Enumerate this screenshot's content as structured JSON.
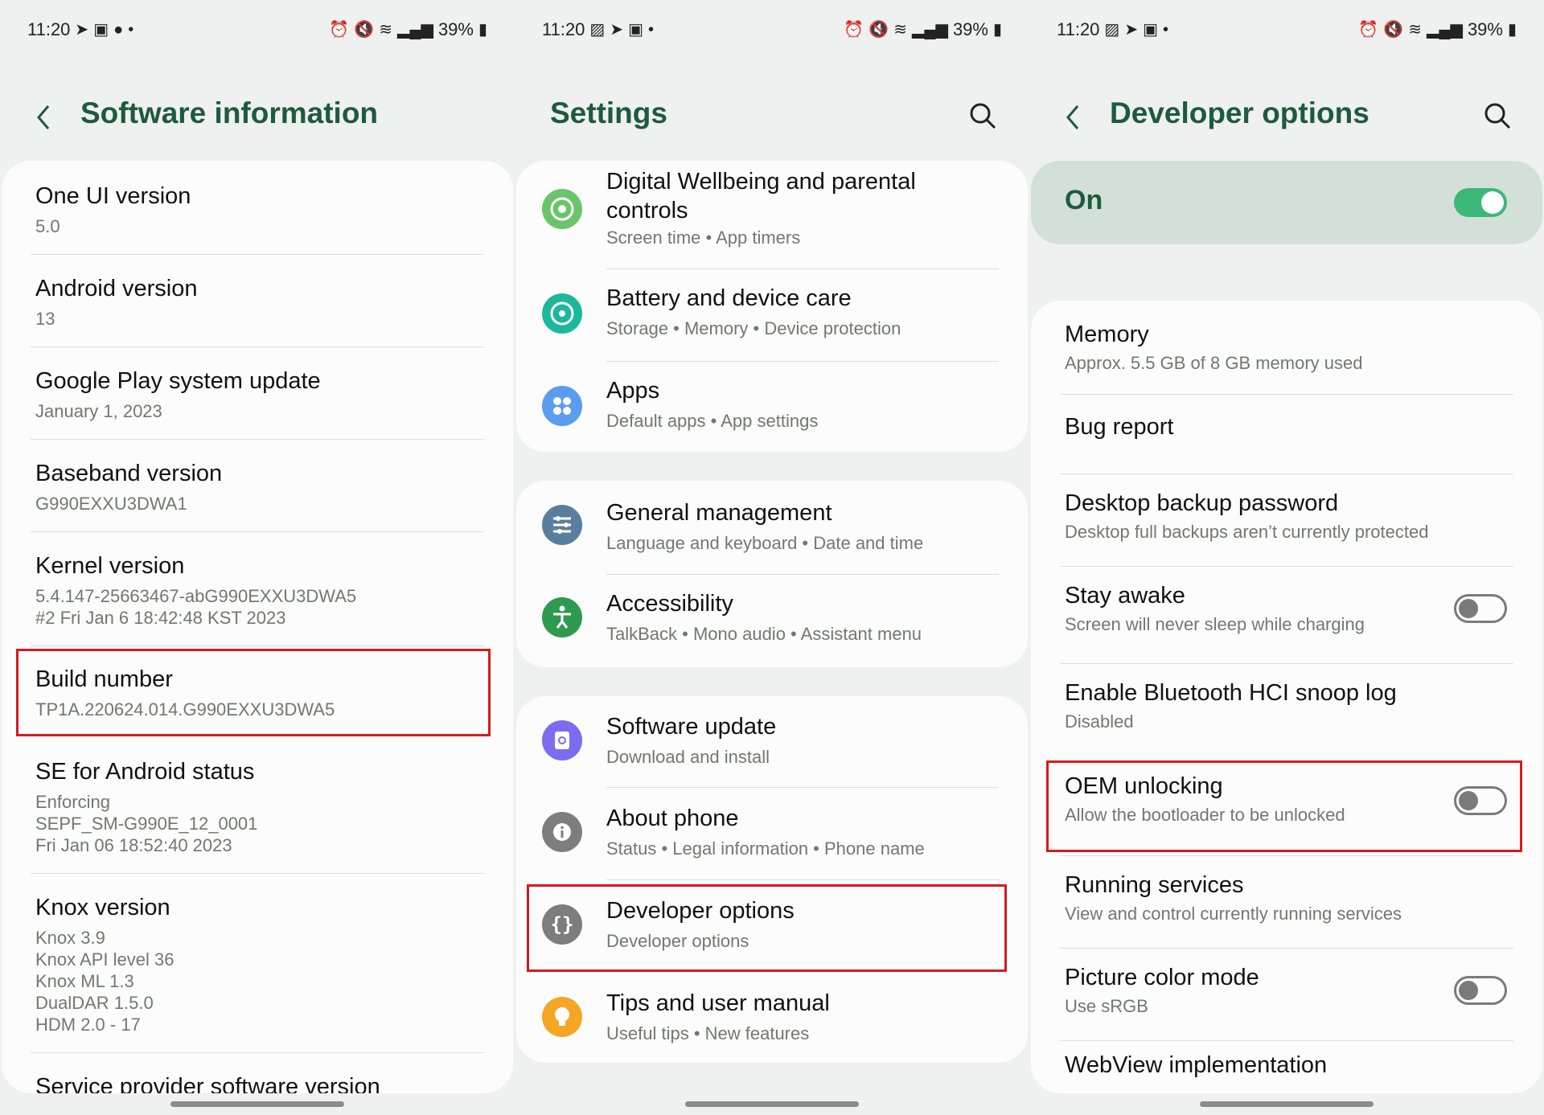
{
  "status_bar": {
    "time": "11:20",
    "battery": "39%"
  },
  "colors": {
    "accent": "#1e5a3e",
    "highlight": "#d71920",
    "toggle_on": "#3cb878"
  },
  "software_info": {
    "title": "Software information",
    "items": [
      {
        "title": "One UI version",
        "lines": [
          "5.0"
        ]
      },
      {
        "title": "Android version",
        "lines": [
          "13"
        ]
      },
      {
        "title": "Google Play system update",
        "lines": [
          "January 1, 2023"
        ]
      },
      {
        "title": "Baseband version",
        "lines": [
          "G990EXXU3DWA1"
        ]
      },
      {
        "title": "Kernel version",
        "lines": [
          "5.4.147-25663467-abG990EXXU3DWA5",
          "#2 Fri Jan 6 18:42:48 KST 2023"
        ]
      },
      {
        "title": "Build number",
        "lines": [
          "TP1A.220624.014.G990EXXU3DWA5"
        ]
      },
      {
        "title": "SE for Android status",
        "lines": [
          "Enforcing",
          "SEPF_SM-G990E_12_0001",
          "Fri Jan 06 18:52:40 2023"
        ]
      },
      {
        "title": "Knox version",
        "lines": [
          "Knox 3.9",
          "Knox API level 36",
          "Knox ML 1.3",
          "DualDAR 1.5.0",
          "HDM 2.0 - 17"
        ]
      },
      {
        "title": "Service provider software version",
        "lines": []
      }
    ]
  },
  "settings": {
    "title": "Settings",
    "items": [
      {
        "title_line1": "Digital Wellbeing and parental",
        "title_line2": "controls",
        "subtitle": "Screen time  •  App timers",
        "icon": "digital-wellbeing-icon",
        "color": "#6cc46a"
      },
      {
        "title": "Battery and device care",
        "subtitle": "Storage  •  Memory  •  Device protection",
        "icon": "device-care-icon",
        "color": "#1bb89a"
      },
      {
        "title": "Apps",
        "subtitle": "Default apps  •  App settings",
        "icon": "apps-icon",
        "color": "#5a9cf0"
      },
      {
        "title": "General management",
        "subtitle": "Language and keyboard  •  Date and time",
        "icon": "sliders-icon",
        "color": "#5a7f9e"
      },
      {
        "title": "Accessibility",
        "subtitle": "TalkBack  •  Mono audio  •  Assistant menu",
        "icon": "accessibility-icon",
        "color": "#2e9a50"
      },
      {
        "title": "Software update",
        "subtitle": "Download and install",
        "icon": "software-update-icon",
        "color": "#7c6cf0"
      },
      {
        "title": "About phone",
        "subtitle": "Status  •  Legal information  •  Phone name",
        "icon": "info-icon",
        "color": "#7d7d7d"
      },
      {
        "title": "Developer options",
        "subtitle": "Developer options",
        "icon": "developer-braces-icon",
        "color": "#7d7d7d"
      },
      {
        "title": "Tips and user manual",
        "subtitle": "Useful tips  •  New features",
        "icon": "lightbulb-icon",
        "color": "#f5a623"
      }
    ]
  },
  "developer": {
    "title": "Developer options",
    "master": {
      "label": "On",
      "on": true
    },
    "items": [
      {
        "title": "Memory",
        "subtitle": "Approx. 5.5 GB of 8 GB memory used"
      },
      {
        "title": "Bug report"
      },
      {
        "title": "Desktop backup password",
        "subtitle": "Desktop full backups aren’t currently protected"
      },
      {
        "title": "Stay awake",
        "subtitle": "Screen will never sleep while charging",
        "toggle": false
      },
      {
        "title": "Enable Bluetooth HCI snoop log",
        "subtitle": "Disabled"
      },
      {
        "title": "OEM unlocking",
        "subtitle": "Allow the bootloader to be unlocked",
        "toggle": false
      },
      {
        "title": "Running services",
        "subtitle": "View and control currently running services"
      },
      {
        "title": "Picture color mode",
        "subtitle": "Use sRGB",
        "toggle": false
      },
      {
        "title": "WebView implementation"
      }
    ]
  }
}
